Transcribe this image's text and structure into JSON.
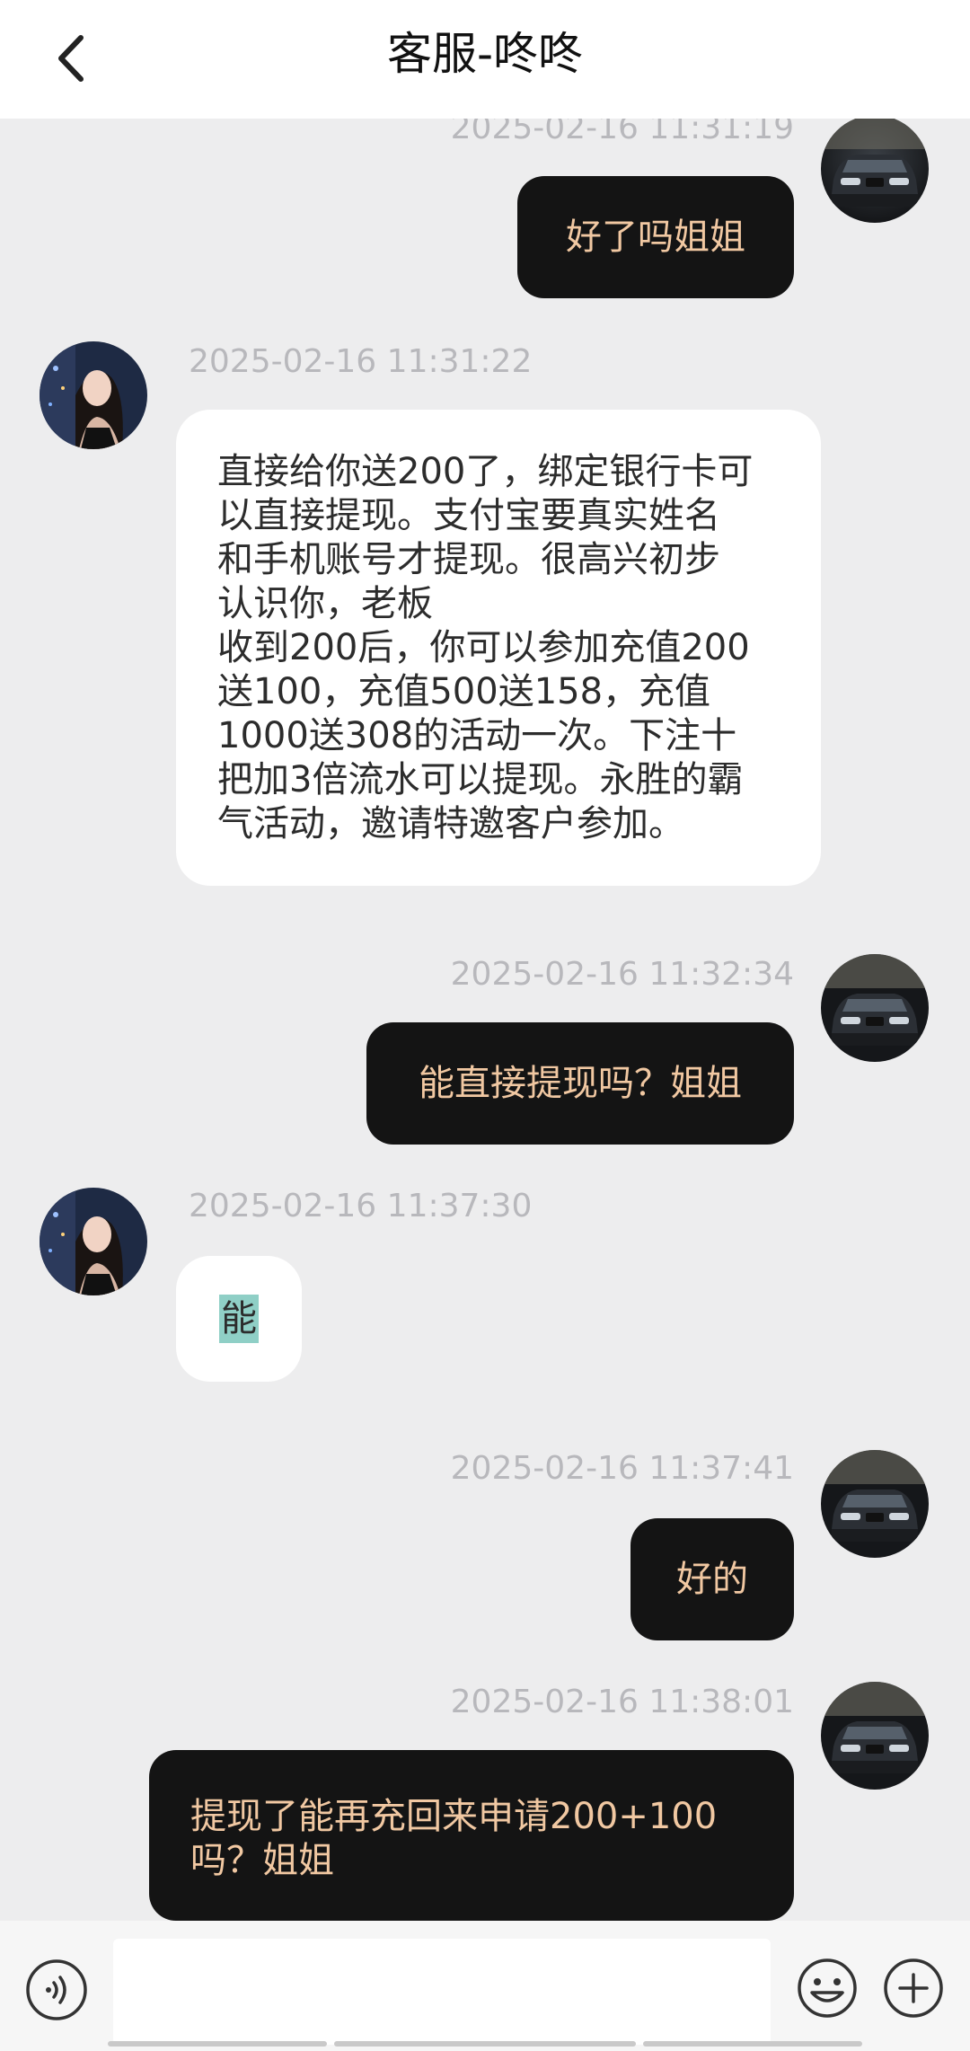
{
  "header": {
    "title": "客服-咚咚"
  },
  "messages": [
    {
      "timestamp": "2025-02-16 11:31:19",
      "text": "好了吗姐姐",
      "side": "out"
    },
    {
      "timestamp": "2025-02-16 11:31:22",
      "text": "直接给你送200了，绑定银行卡可以直接提现。支付宝要真实姓名和手机账号才提现。很高兴初步认识你，老板\n收到200后，你可以参加充值200送100，充值500送158，充值1000送308的活动一次。下注十把加3倍流水可以提现。永胜的霸气活动，邀请特邀客户参加。",
      "side": "in"
    },
    {
      "timestamp": "2025-02-16 11:32:34",
      "text": "能直接提现吗？姐姐",
      "side": "out"
    },
    {
      "timestamp": "2025-02-16 11:37:30",
      "text": "能",
      "side": "in"
    },
    {
      "timestamp": "2025-02-16 11:37:41",
      "text": "好的",
      "side": "out"
    },
    {
      "timestamp": "2025-02-16 11:38:01",
      "text": "提现了能再充回来申请200+100吗？姐姐",
      "side": "out"
    }
  ],
  "message_lines": {
    "m2": [
      "直接给你送200了，绑定银行卡可",
      "以直接提现。支付宝要真实姓名",
      "和手机账号才提现。很高兴初步",
      "认识你，老板",
      "收到200后，你可以参加充值200",
      "送100，充值500送158，充值",
      "1000送308的活动一次。下注十",
      "把加3倍流水可以提现。永胜的霸",
      "气活动，邀请特邀客户参加。"
    ],
    "m6": [
      "提现了能再充回来申请200+100",
      "吗？姐姐"
    ]
  },
  "input": {
    "value": ""
  },
  "colors": {
    "outgoing_bubble": "#141414",
    "outgoing_text": "#f1c8a2",
    "incoming_bubble": "#ffffff",
    "background": "#ededee"
  },
  "icons": [
    "back-arrow-icon",
    "voice-icon",
    "emoji-icon",
    "plus-icon"
  ]
}
